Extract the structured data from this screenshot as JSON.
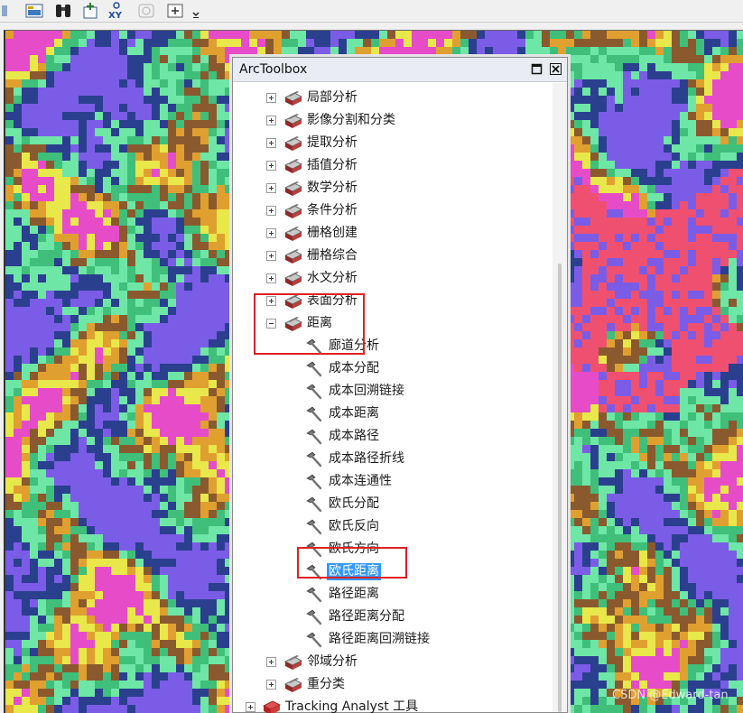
{
  "window": {
    "title": "ArcToolbox"
  },
  "toolbar": {
    "icons": [
      "layout-icon",
      "binoculars-icon",
      "add-data-icon",
      "xy-goto-icon",
      "time-slider-icon",
      "zoom-window-icon",
      "overflow-chevron-icon"
    ]
  },
  "tree": {
    "toolsets": [
      {
        "label": "局部分析",
        "expanded": false
      },
      {
        "label": "影像分割和分类",
        "expanded": false
      },
      {
        "label": "提取分析",
        "expanded": false
      },
      {
        "label": "插值分析",
        "expanded": false
      },
      {
        "label": "数学分析",
        "expanded": false
      },
      {
        "label": "条件分析",
        "expanded": false
      },
      {
        "label": "栅格创建",
        "expanded": false
      },
      {
        "label": "栅格综合",
        "expanded": false
      },
      {
        "label": "水文分析",
        "expanded": false
      },
      {
        "label": "表面分析",
        "expanded": false
      },
      {
        "label": "距离",
        "expanded": true
      }
    ],
    "distance_tools": [
      {
        "label": "廊道分析"
      },
      {
        "label": "成本分配"
      },
      {
        "label": "成本回溯链接"
      },
      {
        "label": "成本距离"
      },
      {
        "label": "成本路径"
      },
      {
        "label": "成本路径折线"
      },
      {
        "label": "成本连通性"
      },
      {
        "label": "欧氏分配"
      },
      {
        "label": "欧氏反向"
      },
      {
        "label": "欧氏方向"
      },
      {
        "label": "欧氏距离",
        "selected": true
      },
      {
        "label": "路径距离"
      },
      {
        "label": "路径距离分配"
      },
      {
        "label": "路径距离回溯链接"
      }
    ],
    "after_toolsets": [
      {
        "label": "邻域分析",
        "expanded": false
      },
      {
        "label": "重分类",
        "expanded": false
      }
    ],
    "top_toolbox": {
      "label": "Tracking Analyst 工具",
      "expanded": false
    }
  },
  "watermark": "CSDN @Edward-tan",
  "colors": {
    "highlight_box": "#e02020",
    "selection": "#3399ff",
    "map_palette": [
      "#3fbf7a",
      "#2b3f8f",
      "#e8e84a",
      "#e0a030",
      "#e64cc8",
      "#7b5ce6",
      "#8a5a2e",
      "#6ee6a6",
      "#ef5070"
    ]
  }
}
